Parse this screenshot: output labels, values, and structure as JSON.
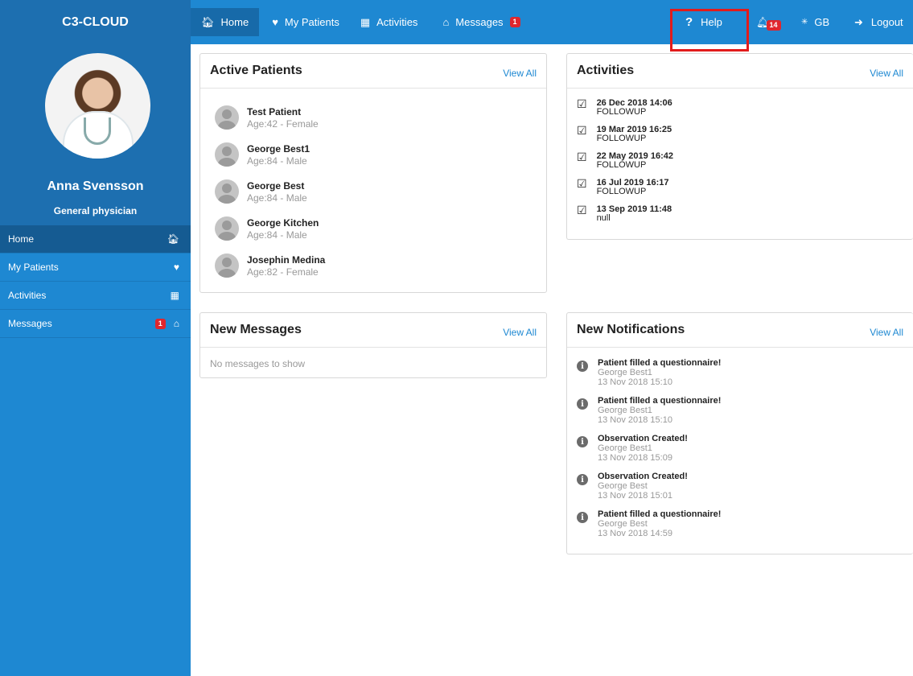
{
  "brand": "C3-CLOUD",
  "nav": {
    "home": "Home",
    "my_patients": "My Patients",
    "activities": "Activities",
    "messages": "Messages",
    "messages_badge": "1",
    "help": "Help",
    "notifications_badge": "14",
    "language": "GB",
    "logout": "Logout"
  },
  "profile": {
    "name": "Anna Svensson",
    "role": "General physician"
  },
  "sidebar": {
    "items": [
      {
        "label": "Home"
      },
      {
        "label": "My Patients"
      },
      {
        "label": "Activities"
      },
      {
        "label": "Messages",
        "badge": "1"
      }
    ]
  },
  "active_patients": {
    "title": "Active Patients",
    "view_all": "View All",
    "patients": [
      {
        "name": "Test Patient",
        "info": "Age:42 - Female"
      },
      {
        "name": "George Best1",
        "info": "Age:84 - Male"
      },
      {
        "name": "George Best",
        "info": "Age:84 - Male"
      },
      {
        "name": "George Kitchen",
        "info": "Age:84 - Male"
      },
      {
        "name": "Josephin Medina",
        "info": "Age:82 - Female"
      }
    ]
  },
  "activities": {
    "title": "Activities",
    "view_all": "View All",
    "items": [
      {
        "date": "26 Dec 2018 14:06",
        "type": "FOLLOWUP"
      },
      {
        "date": "19 Mar 2019 16:25",
        "type": "FOLLOWUP"
      },
      {
        "date": "22 May 2019 16:42",
        "type": "FOLLOWUP"
      },
      {
        "date": "16 Jul 2019 16:17",
        "type": "FOLLOWUP"
      },
      {
        "date": "13 Sep 2019 11:48",
        "type": "null"
      }
    ]
  },
  "new_messages": {
    "title": "New Messages",
    "view_all": "View All",
    "empty": "No messages to show"
  },
  "notifications": {
    "title": "New Notifications",
    "view_all": "View All",
    "items": [
      {
        "title": "Patient filled a questionnaire!",
        "patient": "George Best1",
        "time": "13 Nov 2018 15:10"
      },
      {
        "title": "Patient filled a questionnaire!",
        "patient": "George Best1",
        "time": "13 Nov 2018 15:10"
      },
      {
        "title": "Observation Created!",
        "patient": "George Best1",
        "time": "13 Nov 2018 15:09"
      },
      {
        "title": "Observation Created!",
        "patient": "George Best",
        "time": "13 Nov 2018 15:01"
      },
      {
        "title": "Patient filled a questionnaire!",
        "patient": "George Best",
        "time": "13 Nov 2018 14:59"
      }
    ]
  }
}
